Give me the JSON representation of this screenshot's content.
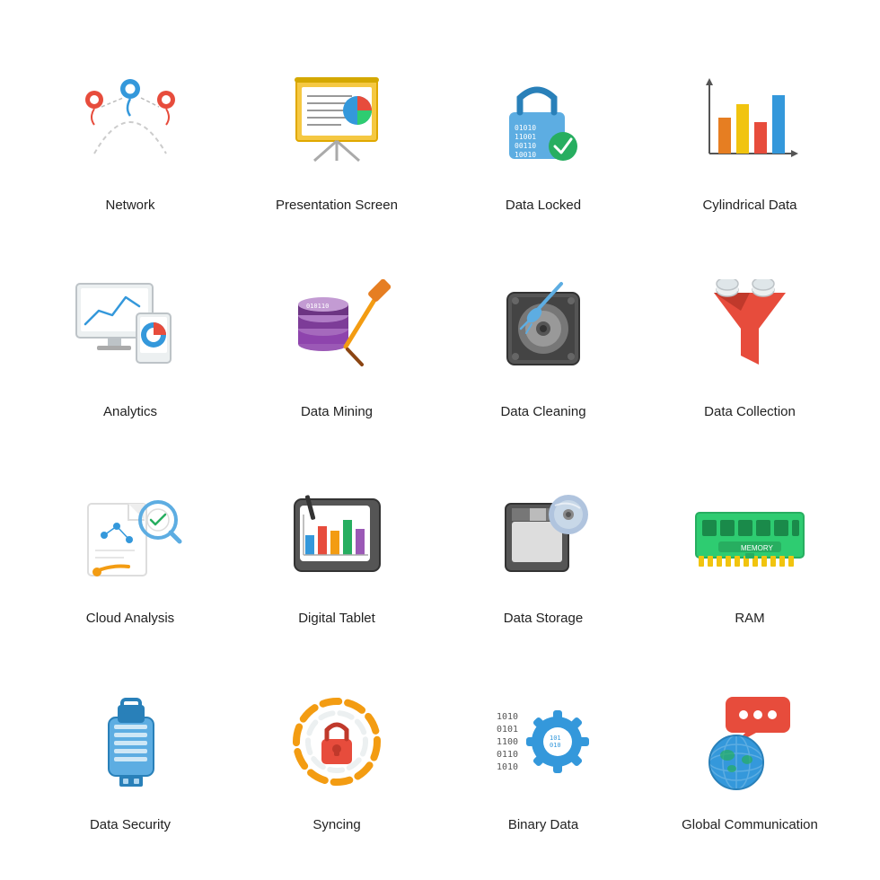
{
  "icons": [
    {
      "id": "network",
      "label": "Network"
    },
    {
      "id": "presentation-screen",
      "label": "Presentation Screen"
    },
    {
      "id": "data-locked",
      "label": "Data Locked"
    },
    {
      "id": "cylindrical-data",
      "label": "Cylindrical Data"
    },
    {
      "id": "analytics",
      "label": "Analytics"
    },
    {
      "id": "data-mining",
      "label": "Data Mining"
    },
    {
      "id": "data-cleaning",
      "label": "Data Cleaning"
    },
    {
      "id": "data-collection",
      "label": "Data Collection"
    },
    {
      "id": "cloud-analysis",
      "label": "Cloud Analysis"
    },
    {
      "id": "digital-tablet",
      "label": "Digital Tablet"
    },
    {
      "id": "data-storage",
      "label": "Data Storage"
    },
    {
      "id": "ram",
      "label": "RAM"
    },
    {
      "id": "data-security",
      "label": "Data Security"
    },
    {
      "id": "syncing",
      "label": "Syncing"
    },
    {
      "id": "binary-data",
      "label": "Binary Data"
    },
    {
      "id": "global-communication",
      "label": "Global Communication"
    }
  ]
}
